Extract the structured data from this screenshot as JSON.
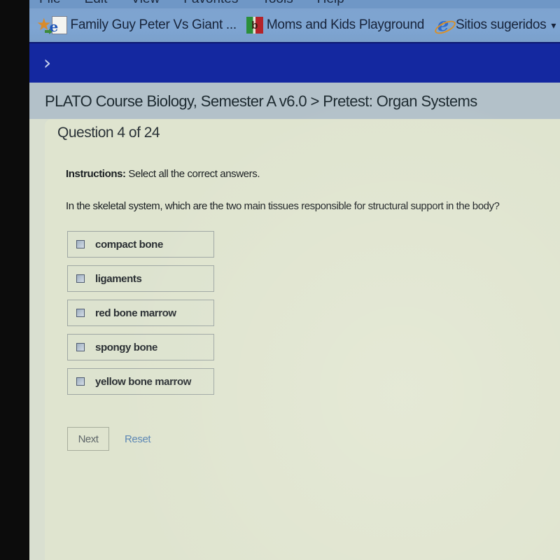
{
  "browser": {
    "menu": [
      "File",
      "Edit",
      "View",
      "Favorites",
      "Tools",
      "Help"
    ],
    "favorites": [
      {
        "icon": "ie-page-icon",
        "label": "Family Guy Peter Vs Giant ..."
      },
      {
        "icon": "pb-site-icon",
        "label": "Moms and Kids Playground"
      },
      {
        "icon": "internet-explorer-icon",
        "label": "Sitios sugeridos"
      }
    ],
    "favorites_more": "▾"
  },
  "header": {
    "nav_toggle": "›",
    "breadcrumb": "PLATO Course Biology, Semester A v6.0 > Pretest: Organ Systems"
  },
  "question": {
    "counter": "Question 4 of 24",
    "instructions_label": "Instructions:",
    "instructions_text": " Select all the correct answers.",
    "prompt": "In the skeletal system, which are the two main tissues responsible for structural support in the body?",
    "options": [
      {
        "label": "compact bone",
        "checked": false
      },
      {
        "label": "ligaments",
        "checked": false
      },
      {
        "label": "red bone marrow",
        "checked": false
      },
      {
        "label": "spongy bone",
        "checked": false
      },
      {
        "label": "yellow bone marrow",
        "checked": false
      }
    ]
  },
  "actions": {
    "next_label": "Next",
    "reset_label": "Reset"
  }
}
